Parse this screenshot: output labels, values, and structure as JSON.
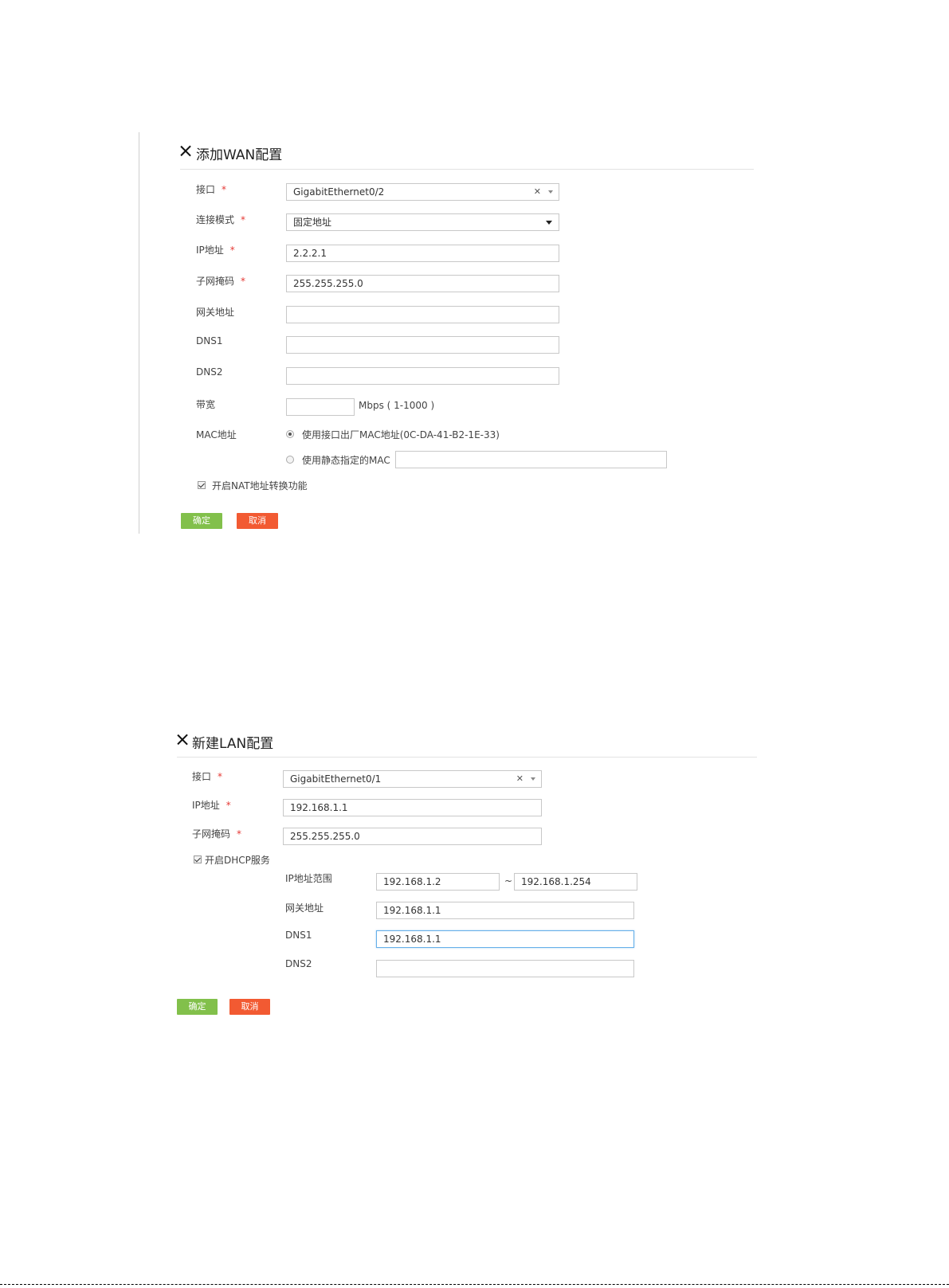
{
  "wan": {
    "title": "添加WAN配置",
    "interface_label": "接口",
    "interface_value": "GigabitEthernet0/2",
    "mode_label": "连接模式",
    "mode_value": "固定地址",
    "ip_label": "IP地址",
    "ip_value": "2.2.2.1",
    "mask_label": "子网掩码",
    "mask_value": "255.255.255.0",
    "gateway_label": "网关地址",
    "gateway_value": "",
    "dns1_label": "DNS1",
    "dns1_value": "",
    "dns2_label": "DNS2",
    "dns2_value": "",
    "bandwidth_label": "带宽",
    "bandwidth_value": "",
    "bandwidth_unit": "Mbps ( 1-1000 )",
    "mac_label": "MAC地址",
    "mac_option_factory": "使用接口出厂MAC地址(0C-DA-41-B2-1E-33)",
    "mac_option_static": "使用静态指定的MAC",
    "mac_static_value": "",
    "nat_label": "开启NAT地址转换功能",
    "ok_label": "确定",
    "cancel_label": "取消"
  },
  "lan": {
    "title": "新建LAN配置",
    "interface_label": "接口",
    "interface_value": "GigabitEthernet0/1",
    "ip_label": "IP地址",
    "ip_value": "192.168.1.1",
    "mask_label": "子网掩码",
    "mask_value": "255.255.255.0",
    "dhcp_label": "开启DHCP服务",
    "range_label": "IP地址范围",
    "range_start": "192.168.1.2",
    "range_sep": "~",
    "range_end": "192.168.1.254",
    "gateway_label": "网关地址",
    "gateway_value": "192.168.1.1",
    "dns1_label": "DNS1",
    "dns1_value": "192.168.1.1",
    "dns2_label": "DNS2",
    "dns2_value": "",
    "ok_label": "确定",
    "cancel_label": "取消"
  },
  "required_mark": "*"
}
